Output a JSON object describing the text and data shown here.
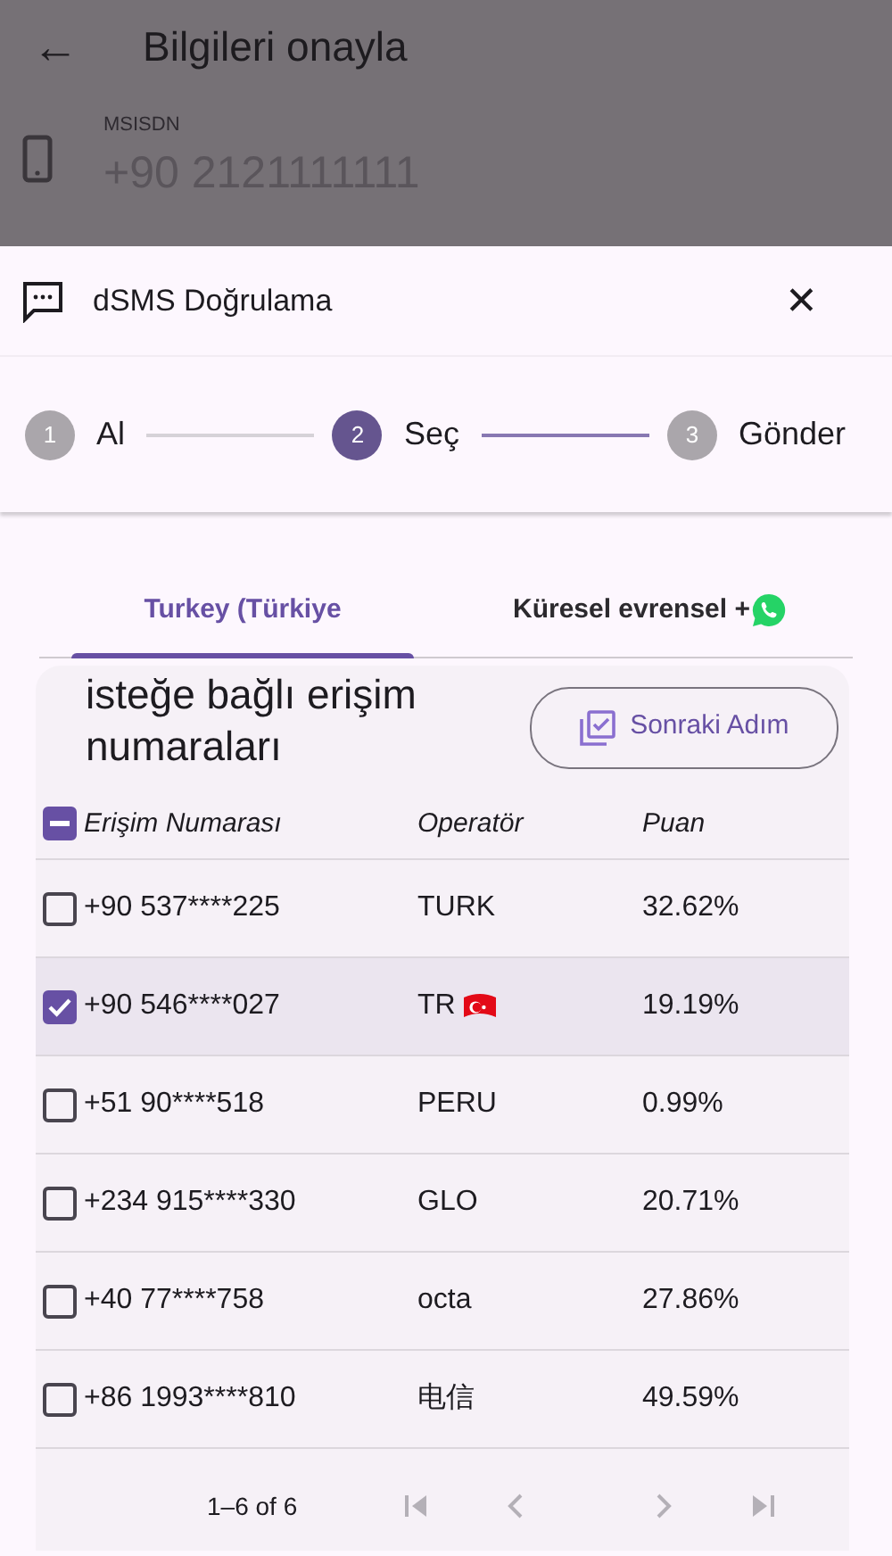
{
  "app_bar": {
    "back": "←",
    "title": "Bilgileri onayla"
  },
  "msisdn": {
    "label": "MSISDN",
    "value": "+90 2121111111"
  },
  "sheet": {
    "title": "dSMS Doğrulama",
    "close": "✕"
  },
  "steps": [
    {
      "number": "1",
      "label": "Al",
      "selected": false
    },
    {
      "number": "2",
      "label": "Seç",
      "selected": true
    },
    {
      "number": "3",
      "label": "Gönder",
      "selected": false
    }
  ],
  "tabs": [
    {
      "label": "Turkey (Türkiye",
      "selected": true
    },
    {
      "label": "Küresel evrensel +",
      "selected": false
    }
  ],
  "card": {
    "title": "isteğe bağlı erişim numaraları",
    "button": "Sonraki Adım"
  },
  "table": {
    "select_all_indeterminate": true,
    "columns": [
      "Erişim Numarası",
      "Operatör",
      "Puan"
    ],
    "rows": [
      {
        "number": "+90 537****225",
        "operator": "TURK",
        "score": "32.62%",
        "selected": false,
        "kind": "plain"
      },
      {
        "number": "+90 546****027",
        "operator": "TR",
        "score": "19.19%",
        "selected": true,
        "kind": "flag"
      },
      {
        "number": "+51 90****518",
        "operator": "PERU",
        "score": "0.99%",
        "selected": false,
        "kind": "plain"
      },
      {
        "number": "+234 915****330",
        "operator": "GLO",
        "score": "20.71%",
        "selected": false,
        "kind": "plain"
      },
      {
        "number": "+40 77****758",
        "operator": "octa",
        "score": "27.86%",
        "selected": false,
        "kind": "plain"
      },
      {
        "number": "+86 1993****810",
        "operator": "电信",
        "score": "49.59%",
        "selected": false,
        "kind": "plain"
      }
    ]
  },
  "pagination": {
    "range": "1–6 of 6"
  }
}
